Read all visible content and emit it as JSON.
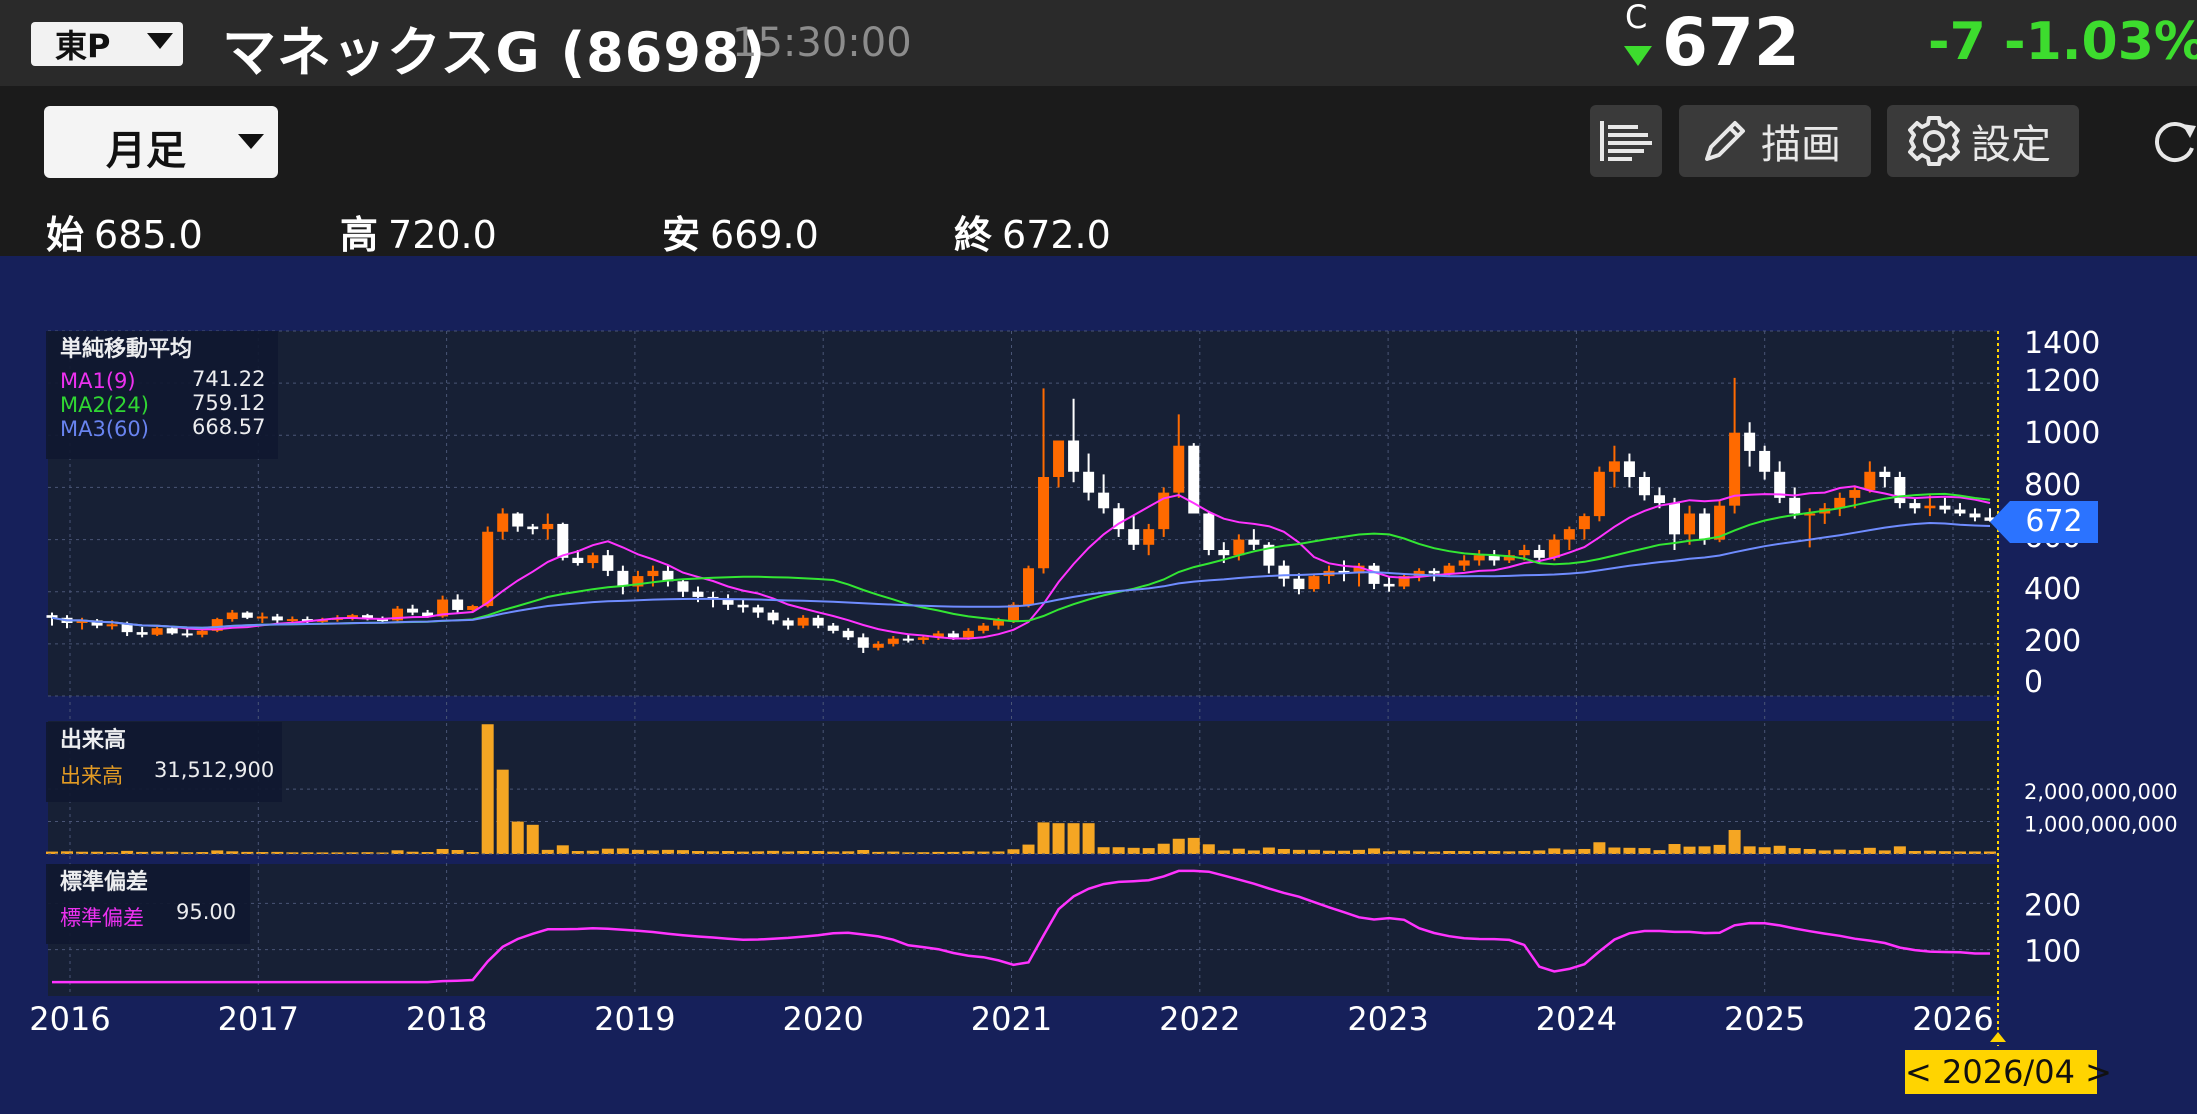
{
  "header": {
    "market": "東P",
    "stock_name": "マネックスG (8698)",
    "time": "15:30:00",
    "c_mark": "C",
    "price": "672",
    "change": "-7",
    "change_pct": "-1.03%"
  },
  "toolbar": {
    "period": "月足",
    "draw_label": "描画",
    "settings_label": "設定"
  },
  "ohlc": [
    {
      "key": "始",
      "value": "685.0"
    },
    {
      "key": "高",
      "value": "720.0"
    },
    {
      "key": "安",
      "value": "669.0"
    },
    {
      "key": "終",
      "value": "672.0"
    }
  ],
  "colors": {
    "up": "#ff6a00",
    "down": "#ffffff",
    "ma1": "#ff33ff",
    "ma2": "#33e633",
    "ma3": "#6f8cff",
    "volume": "#f5a623",
    "stddev": "#ff33ff"
  },
  "legend_price": {
    "title": "単純移動平均",
    "rows": [
      {
        "name": "MA1(9)",
        "value": "741.22"
      },
      {
        "name": "MA2(24)",
        "value": "759.12"
      },
      {
        "name": "MA3(60)",
        "value": "668.57"
      }
    ]
  },
  "legend_volume": {
    "title": "出来高",
    "name": "出来高",
    "value": "31,512,900"
  },
  "legend_stddev": {
    "title": "標準偏差",
    "name": "標準偏差",
    "value": "95.00"
  },
  "current_price_tag": "672",
  "date_badge": "< 2026/04 >",
  "chart_data": {
    "type": "candlestick",
    "x_labels": [
      "2016",
      "2017",
      "2018",
      "2019",
      "2020",
      "2021",
      "2022",
      "2023",
      "2024",
      "2025",
      "2026"
    ],
    "price_ticks": [
      "1400",
      "1200",
      "1000",
      "800",
      "600",
      "400",
      "200",
      "0"
    ],
    "price_ylim": [
      0,
      1400
    ],
    "volume_ticks": [
      "2,000,000,000",
      "1,000,000,000"
    ],
    "stddev_ticks": [
      "200",
      "100"
    ],
    "grid": true,
    "candles": [
      [
        310,
        320,
        270,
        300
      ],
      [
        300,
        310,
        260,
        280
      ],
      [
        280,
        300,
        255,
        290
      ],
      [
        290,
        295,
        260,
        270
      ],
      [
        270,
        290,
        255,
        275
      ],
      [
        275,
        285,
        230,
        245
      ],
      [
        245,
        265,
        225,
        235
      ],
      [
        235,
        265,
        230,
        260
      ],
      [
        260,
        270,
        235,
        240
      ],
      [
        240,
        258,
        225,
        235
      ],
      [
        235,
        255,
        225,
        250
      ],
      [
        250,
        300,
        245,
        295
      ],
      [
        295,
        330,
        285,
        320
      ],
      [
        320,
        325,
        295,
        300
      ],
      [
        300,
        320,
        280,
        305
      ],
      [
        305,
        315,
        280,
        290
      ],
      [
        290,
        305,
        275,
        295
      ],
      [
        295,
        305,
        280,
        285
      ],
      [
        285,
        300,
        275,
        292
      ],
      [
        292,
        310,
        285,
        300
      ],
      [
        300,
        315,
        290,
        310
      ],
      [
        310,
        315,
        290,
        295
      ],
      [
        295,
        305,
        280,
        290
      ],
      [
        290,
        345,
        285,
        335
      ],
      [
        335,
        350,
        310,
        320
      ],
      [
        320,
        330,
        300,
        305
      ],
      [
        305,
        385,
        300,
        370
      ],
      [
        370,
        390,
        315,
        330
      ],
      [
        330,
        350,
        320,
        345
      ],
      [
        345,
        650,
        340,
        630
      ],
      [
        630,
        720,
        600,
        700
      ],
      [
        700,
        705,
        630,
        650
      ],
      [
        650,
        660,
        620,
        640
      ],
      [
        640,
        700,
        600,
        660
      ],
      [
        660,
        665,
        520,
        530
      ],
      [
        530,
        560,
        500,
        510
      ],
      [
        510,
        550,
        490,
        540
      ],
      [
        540,
        560,
        460,
        480
      ],
      [
        480,
        500,
        390,
        420
      ],
      [
        420,
        480,
        400,
        460
      ],
      [
        460,
        500,
        420,
        480
      ],
      [
        480,
        500,
        420,
        440
      ],
      [
        440,
        450,
        380,
        400
      ],
      [
        400,
        420,
        360,
        380
      ],
      [
        380,
        400,
        340,
        370
      ],
      [
        370,
        390,
        330,
        350
      ],
      [
        350,
        370,
        320,
        340
      ],
      [
        340,
        350,
        300,
        320
      ],
      [
        320,
        330,
        275,
        290
      ],
      [
        290,
        300,
        255,
        270
      ],
      [
        270,
        310,
        260,
        300
      ],
      [
        300,
        310,
        260,
        270
      ],
      [
        270,
        280,
        240,
        250
      ],
      [
        250,
        260,
        215,
        225
      ],
      [
        225,
        240,
        165,
        185
      ],
      [
        185,
        210,
        175,
        200
      ],
      [
        200,
        230,
        190,
        220
      ],
      [
        220,
        235,
        205,
        215
      ],
      [
        215,
        230,
        200,
        225
      ],
      [
        225,
        250,
        215,
        240
      ],
      [
        240,
        250,
        215,
        225
      ],
      [
        225,
        260,
        215,
        250
      ],
      [
        250,
        280,
        240,
        270
      ],
      [
        270,
        300,
        255,
        290
      ],
      [
        290,
        360,
        280,
        350
      ],
      [
        350,
        500,
        340,
        490
      ],
      [
        490,
        1180,
        470,
        840
      ],
      [
        840,
        980,
        800,
        980
      ],
      [
        980,
        1140,
        820,
        860
      ],
      [
        860,
        930,
        750,
        780
      ],
      [
        780,
        850,
        700,
        720
      ],
      [
        720,
        740,
        610,
        640
      ],
      [
        640,
        690,
        560,
        580
      ],
      [
        580,
        660,
        540,
        640
      ],
      [
        640,
        800,
        610,
        780
      ],
      [
        780,
        1080,
        760,
        960
      ],
      [
        960,
        970,
        700,
        700
      ],
      [
        700,
        710,
        540,
        560
      ],
      [
        560,
        590,
        510,
        540
      ],
      [
        540,
        620,
        520,
        600
      ],
      [
        600,
        640,
        560,
        580
      ],
      [
        580,
        590,
        470,
        500
      ],
      [
        500,
        520,
        420,
        450
      ],
      [
        450,
        470,
        390,
        410
      ],
      [
        410,
        470,
        400,
        460
      ],
      [
        460,
        500,
        430,
        480
      ],
      [
        480,
        520,
        440,
        470
      ],
      [
        470,
        510,
        420,
        500
      ],
      [
        500,
        510,
        410,
        430
      ],
      [
        430,
        460,
        400,
        420
      ],
      [
        420,
        470,
        410,
        460
      ],
      [
        460,
        490,
        440,
        480
      ],
      [
        480,
        490,
        440,
        470
      ],
      [
        470,
        510,
        460,
        500
      ],
      [
        500,
        540,
        480,
        520
      ],
      [
        520,
        560,
        500,
        540
      ],
      [
        540,
        560,
        500,
        520
      ],
      [
        520,
        560,
        510,
        540
      ],
      [
        540,
        580,
        520,
        560
      ],
      [
        560,
        580,
        510,
        530
      ],
      [
        530,
        620,
        520,
        600
      ],
      [
        600,
        650,
        560,
        640
      ],
      [
        640,
        700,
        600,
        690
      ],
      [
        690,
        880,
        670,
        860
      ],
      [
        860,
        960,
        800,
        900
      ],
      [
        900,
        930,
        800,
        840
      ],
      [
        840,
        860,
        750,
        770
      ],
      [
        770,
        800,
        720,
        740
      ],
      [
        740,
        760,
        560,
        620
      ],
      [
        620,
        730,
        580,
        700
      ],
      [
        700,
        720,
        580,
        600
      ],
      [
        600,
        750,
        590,
        730
      ],
      [
        730,
        1220,
        700,
        1010
      ],
      [
        1010,
        1050,
        880,
        940
      ],
      [
        940,
        960,
        830,
        860
      ],
      [
        860,
        900,
        740,
        760
      ],
      [
        760,
        800,
        680,
        700
      ],
      [
        700,
        720,
        570,
        700
      ],
      [
        700,
        740,
        660,
        720
      ],
      [
        720,
        780,
        690,
        760
      ],
      [
        760,
        800,
        720,
        790
      ],
      [
        790,
        900,
        780,
        860
      ],
      [
        860,
        880,
        800,
        840
      ],
      [
        840,
        860,
        720,
        740
      ],
      [
        740,
        760,
        700,
        720
      ],
      [
        720,
        770,
        690,
        730
      ],
      [
        730,
        760,
        700,
        715
      ],
      [
        715,
        740,
        690,
        700
      ],
      [
        700,
        720,
        670,
        685
      ],
      [
        685,
        720,
        669,
        672
      ]
    ]
  }
}
